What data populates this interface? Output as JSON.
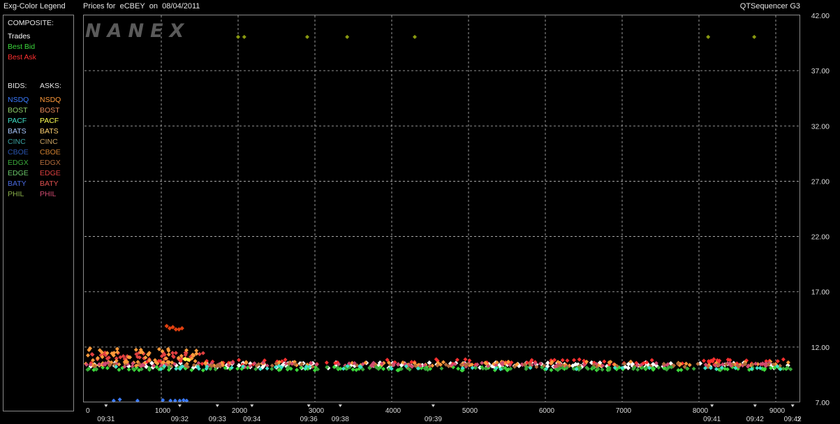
{
  "header": {
    "left_title": "Exg-Color Legend",
    "chart_title_prefix": "Prices for",
    "symbol": "eCBEY",
    "date_word": "on",
    "date": "08/04/2011",
    "app_name": "QTSequencer G3"
  },
  "watermark": "NANEX",
  "legend": {
    "composite_heading": "COMPOSITE:",
    "composite": [
      {
        "label": "Trades",
        "color": "#ffffff"
      },
      {
        "label": "Best Bid",
        "color": "#3cd83c"
      },
      {
        "label": "Best Ask",
        "color": "#ff3030"
      }
    ],
    "bids_heading": "BIDS:",
    "asks_heading": "ASKS:",
    "bids": [
      {
        "label": "NSDQ",
        "color": "#3a7bff"
      },
      {
        "label": "BOST",
        "color": "#8fd06a"
      },
      {
        "label": "PACF",
        "color": "#3fe0c8"
      },
      {
        "label": "BATS",
        "color": "#a8c8ff"
      },
      {
        "label": "CINC",
        "color": "#3aa0a0"
      },
      {
        "label": "CBOE",
        "color": "#2a55b0"
      },
      {
        "label": "EDGX",
        "color": "#3aa83a"
      },
      {
        "label": "EDGE",
        "color": "#6ac86a"
      },
      {
        "label": "BATY",
        "color": "#4a6ae0"
      },
      {
        "label": "PHIL",
        "color": "#8ab04a"
      }
    ],
    "asks": [
      {
        "label": "NSDQ",
        "color": "#ff9a3a"
      },
      {
        "label": "BOST",
        "color": "#e88a5a"
      },
      {
        "label": "PACF",
        "color": "#ffff50"
      },
      {
        "label": "BATS",
        "color": "#ffd070"
      },
      {
        "label": "CINC",
        "color": "#c8a060"
      },
      {
        "label": "CBOE",
        "color": "#d08030"
      },
      {
        "label": "EDGX",
        "color": "#b06a3a"
      },
      {
        "label": "EDGE",
        "color": "#e04040"
      },
      {
        "label": "BATY",
        "color": "#e05050"
      },
      {
        "label": "PHIL",
        "color": "#d04a70"
      }
    ]
  },
  "chart_data": {
    "type": "scatter",
    "title": "Prices for eCBEY on 08/04/2011",
    "xlim": [
      0,
      9300
    ],
    "ylim": [
      7.0,
      42.0
    ],
    "x_ticks": [
      0,
      1000,
      2000,
      3000,
      4000,
      5000,
      6000,
      7000,
      8000,
      9000
    ],
    "y_ticks": [
      "7.00",
      "12.00",
      "17.00",
      "22.00",
      "27.00",
      "32.00",
      "37.00",
      "42.00"
    ],
    "y_tick_values": [
      7,
      12,
      17,
      22,
      27,
      32,
      37,
      42
    ],
    "time_labels": [
      {
        "x": 280,
        "label": "09:31"
      },
      {
        "x": 1240,
        "label": "09:32"
      },
      {
        "x": 1730,
        "label": "09:33"
      },
      {
        "x": 2180,
        "label": "09:34"
      },
      {
        "x": 2920,
        "label": "09:36"
      },
      {
        "x": 3330,
        "label": "09:38"
      },
      {
        "x": 4540,
        "label": "09:39"
      },
      {
        "x": 8170,
        "label": "09:41"
      },
      {
        "x": 8730,
        "label": "09:42"
      },
      {
        "x": 9220,
        "label": "09:42"
      }
    ],
    "grid": true,
    "series": [
      {
        "name": "Trades",
        "color": "#ffffff",
        "band": [
          10.1,
          10.6
        ],
        "x_range": [
          0,
          9200
        ],
        "n": 150
      },
      {
        "name": "Best Bid",
        "color": "#3cd83c",
        "band": [
          9.9,
          10.2
        ],
        "x_range": [
          0,
          9200
        ],
        "n": 110
      },
      {
        "name": "Best Ask",
        "color": "#ff3030",
        "band": [
          10.4,
          10.9
        ],
        "x_range": [
          0,
          9200
        ],
        "n": 90
      },
      {
        "name": "NSDQ ask",
        "color": "#ff9a3a",
        "band": [
          10.3,
          10.7
        ],
        "x_range": [
          0,
          9200
        ],
        "n": 110
      },
      {
        "name": "PHIL ask",
        "color": "#d04a70",
        "band": [
          10.2,
          10.6
        ],
        "x_range": [
          0,
          9200
        ],
        "n": 120
      },
      {
        "name": "EDGX ask",
        "color": "#b06a3a",
        "band": [
          10.2,
          10.5
        ],
        "x_range": [
          0,
          9200
        ],
        "n": 80
      },
      {
        "name": "EDGX bid",
        "color": "#3aa83a",
        "band": [
          9.95,
          10.2
        ],
        "x_range": [
          0,
          9200
        ],
        "n": 80
      },
      {
        "name": "PACF bid",
        "color": "#3fe0c8",
        "band": [
          10.0,
          10.3
        ],
        "x_range": [
          0,
          9200
        ],
        "n": 50
      },
      {
        "name": "EDGE ask",
        "color": "#e04040",
        "band": [
          10.9,
          11.5
        ],
        "x_range": [
          0,
          1600
        ],
        "n": 45
      },
      {
        "name": "NSDQ ask early",
        "color": "#ff9a3a",
        "band": [
          10.6,
          11.9
        ],
        "x_range": [
          0,
          1500
        ],
        "n": 50
      },
      {
        "name": "PACF ask",
        "color": "#ffff50",
        "band": [
          10.8,
          11.0
        ],
        "x_range": [
          1300,
          1500
        ],
        "n": 5
      },
      {
        "name": "NSDQ bid",
        "color": "#3a7bff",
        "band": [
          7.1,
          7.25
        ],
        "x_range": [
          0,
          1400
        ],
        "n": 0
      },
      {
        "name": "EDGE ask high",
        "color": "#e04040",
        "band": [
          13.5,
          13.8
        ],
        "x_range": [
          1100,
          1300
        ],
        "n": 0
      }
    ],
    "points": {
      "olive_top": {
        "color": "#8a9a10",
        "y": 40.05,
        "x": [
          2000,
          2080,
          2900,
          3420,
          4300,
          8120,
          8720
        ]
      },
      "red_high": {
        "color": "#e04010",
        "xy": [
          [
            1070,
            13.9
          ],
          [
            1110,
            13.7
          ],
          [
            1150,
            13.8
          ],
          [
            1190,
            13.6
          ],
          [
            1230,
            13.6
          ],
          [
            1270,
            13.7
          ]
        ]
      },
      "blue_low": {
        "color": "#3a7bff",
        "xy": [
          [
            380,
            7.15
          ],
          [
            460,
            7.25
          ],
          [
            690,
            7.15
          ],
          [
            1020,
            7.2
          ],
          [
            1120,
            7.15
          ],
          [
            1180,
            7.15
          ],
          [
            1240,
            7.15
          ],
          [
            1290,
            7.2
          ],
          [
            1330,
            7.15
          ]
        ]
      }
    }
  }
}
